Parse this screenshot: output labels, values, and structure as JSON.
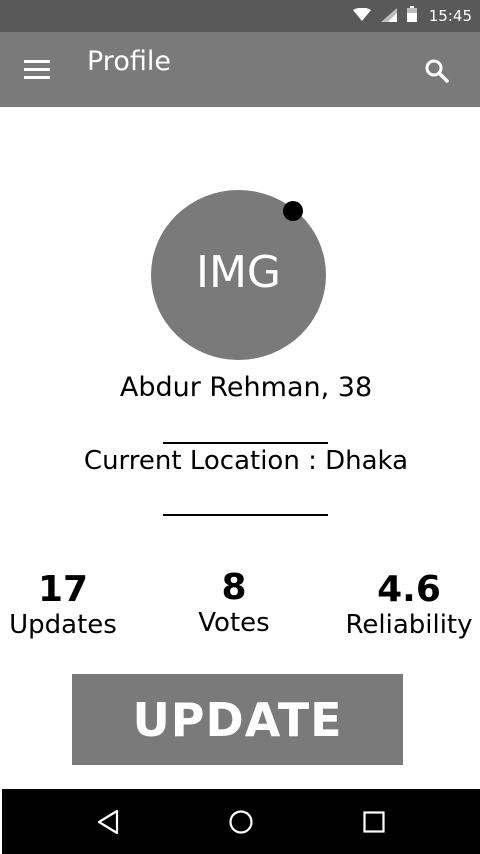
{
  "status_bar": {
    "time": "15:45",
    "icons": [
      "wifi-icon",
      "signal-icon",
      "battery-icon"
    ]
  },
  "app_bar": {
    "title": "Profile",
    "menu_icon": "hamburger-menu-icon",
    "search_icon": "search-icon"
  },
  "profile": {
    "avatar_label": "IMG",
    "name_age": "Abdur Rehman, 38",
    "location": "Current Location : Dhaka"
  },
  "stats": [
    {
      "value": "17",
      "label": "Updates"
    },
    {
      "value": "8",
      "label": "Votes"
    },
    {
      "value": "4.6",
      "label": "Reliability"
    }
  ],
  "actions": {
    "update_label": "UPDATE"
  },
  "nav_bar": {
    "icons": [
      "back-icon",
      "home-icon",
      "recents-icon"
    ]
  },
  "colors": {
    "status_bar": "#595959",
    "app_bar": "#7a7a7a",
    "avatar": "#7a7a7a",
    "button": "#7a7a7a",
    "nav_bar": "#000000"
  }
}
